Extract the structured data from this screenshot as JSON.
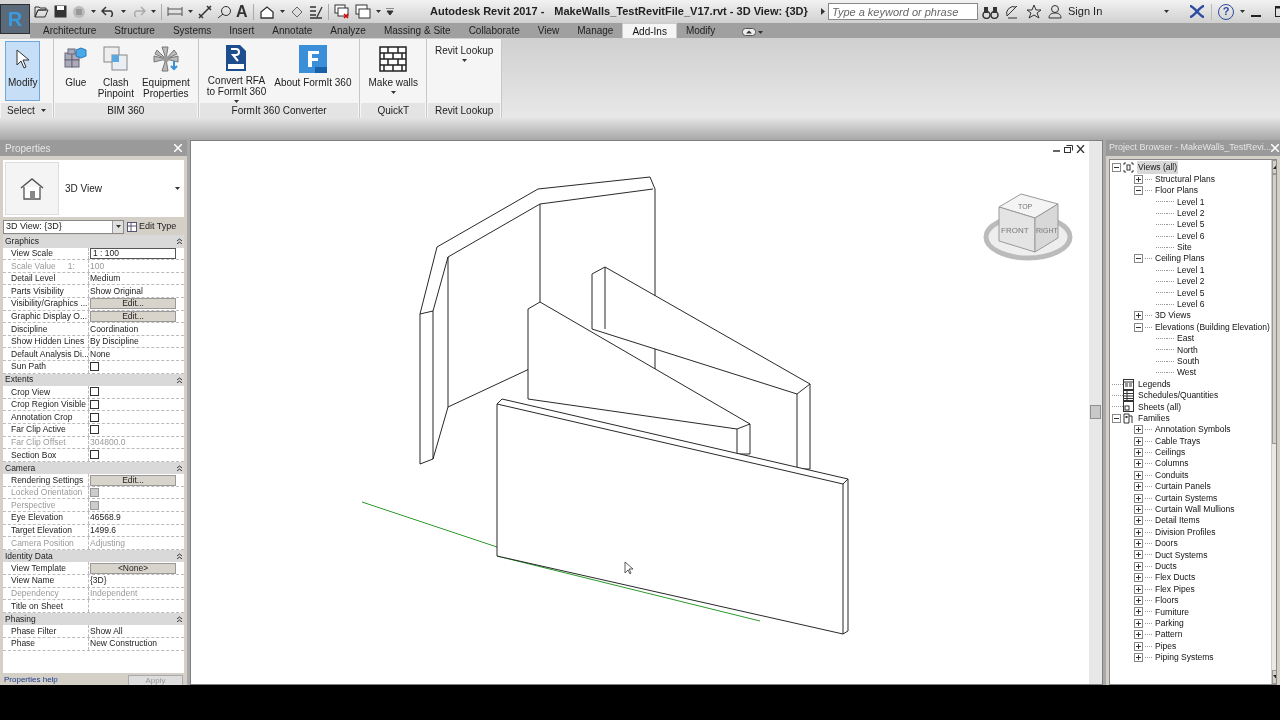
{
  "title_bar": {
    "app_button": "R",
    "text_tool": "A",
    "title_app": "Autodesk Revit 2017 -",
    "title_file": "MakeWalls_TestRevitFile_V17.rvt - 3D View: {3D}",
    "search": {
      "placeholder": "Type a keyword or phrase"
    },
    "sign_in": "Sign In",
    "help": "?"
  },
  "ribbon_tabs": [
    {
      "label": "Architecture",
      "selected": false
    },
    {
      "label": "Structure",
      "selected": false
    },
    {
      "label": "Systems",
      "selected": false
    },
    {
      "label": "Insert",
      "selected": false
    },
    {
      "label": "Annotate",
      "selected": false
    },
    {
      "label": "Analyze",
      "selected": false
    },
    {
      "label": "Massing & Site",
      "selected": false
    },
    {
      "label": "Collaborate",
      "selected": false
    },
    {
      "label": "View",
      "selected": false
    },
    {
      "label": "Manage",
      "selected": false
    },
    {
      "label": "Add-Ins",
      "selected": true
    },
    {
      "label": "Modify",
      "selected": false
    }
  ],
  "ribbon_panels": [
    {
      "title": "Select",
      "title_menu": true,
      "buttons": [
        {
          "label": "Modify",
          "kind": "cursor",
          "selected": true,
          "dropdown": false
        }
      ]
    },
    {
      "title": "BIM 360",
      "title_menu": false,
      "buttons": [
        {
          "label": "Glue",
          "kind": "cubes",
          "selected": false,
          "dropdown": false
        },
        {
          "label": "Clash\nPinpoint",
          "kind": "squares",
          "selected": false,
          "dropdown": false
        },
        {
          "label": "Equipment\nProperties",
          "kind": "fan",
          "selected": false,
          "dropdown": false
        }
      ]
    },
    {
      "title": "FormIt 360 Converter",
      "title_menu": false,
      "buttons": [
        {
          "label": "Convert RFA\nto FormIt 360",
          "kind": "rfa",
          "selected": false,
          "dropdown": true
        },
        {
          "label": "About FormIt 360",
          "kind": "formit",
          "selected": false,
          "dropdown": false
        }
      ]
    },
    {
      "title": "QuickT",
      "title_menu": false,
      "buttons": [
        {
          "label": "Make walls",
          "kind": "bricks",
          "selected": false,
          "dropdown": true
        }
      ]
    },
    {
      "title": "Revit Lookup",
      "title_menu": false,
      "buttons": [
        {
          "label": "Revit Lookup",
          "kind": "text",
          "selected": false,
          "dropdown": true
        }
      ]
    }
  ],
  "properties": {
    "title": "Properties",
    "type_name": "3D View",
    "selector": "3D View: {3D}",
    "edit_type": "Edit Type",
    "sections": [
      {
        "title": "Graphics",
        "rows": [
          {
            "label": "View Scale",
            "kind": "input",
            "value": "1 : 100",
            "disabled": false
          },
          {
            "label": "Scale Value",
            "unit": "1:",
            "kind": "text",
            "value": "100",
            "disabled": true
          },
          {
            "label": "Detail Level",
            "kind": "text",
            "value": "Medium",
            "disabled": false
          },
          {
            "label": "Parts Visibility",
            "kind": "text",
            "value": "Show Original",
            "disabled": false
          },
          {
            "label": "Visibility/Graphics ...",
            "kind": "button",
            "value": "Edit...",
            "disabled": false
          },
          {
            "label": "Graphic Display O...",
            "kind": "button",
            "value": "Edit...",
            "disabled": false
          },
          {
            "label": "Discipline",
            "kind": "text",
            "value": "Coordination",
            "disabled": false
          },
          {
            "label": "Show Hidden Lines",
            "kind": "text",
            "value": "By Discipline",
            "disabled": false
          },
          {
            "label": "Default Analysis Di...",
            "kind": "text",
            "value": "None",
            "disabled": false
          },
          {
            "label": "Sun Path",
            "kind": "checkbox",
            "checked": false,
            "disabled": false
          }
        ]
      },
      {
        "title": "Extents",
        "rows": [
          {
            "label": "Crop View",
            "kind": "checkbox",
            "checked": false,
            "disabled": false
          },
          {
            "label": "Crop Region Visible",
            "kind": "checkbox",
            "checked": false,
            "disabled": false
          },
          {
            "label": "Annotation Crop",
            "kind": "checkbox",
            "checked": false,
            "disabled": false
          },
          {
            "label": "Far Clip Active",
            "kind": "checkbox",
            "checked": false,
            "disabled": false
          },
          {
            "label": "Far Clip Offset",
            "kind": "text",
            "value": "304800.0",
            "disabled": true
          },
          {
            "label": "Section Box",
            "kind": "checkbox",
            "checked": false,
            "disabled": false
          }
        ]
      },
      {
        "title": "Camera",
        "rows": [
          {
            "label": "Rendering Settings",
            "kind": "button",
            "value": "Edit...",
            "disabled": false
          },
          {
            "label": "Locked Orientation",
            "kind": "checkbox",
            "checked": false,
            "disabled": true
          },
          {
            "label": "Perspective",
            "kind": "checkbox",
            "checked": false,
            "disabled": true
          },
          {
            "label": "Eye Elevation",
            "kind": "text",
            "value": "46568.9",
            "disabled": false
          },
          {
            "label": "Target Elevation",
            "kind": "text",
            "value": "1499.6",
            "disabled": false
          },
          {
            "label": "Camera Position",
            "kind": "text",
            "value": "Adjusting",
            "disabled": true
          }
        ]
      },
      {
        "title": "Identity Data",
        "rows": [
          {
            "label": "View Template",
            "kind": "button",
            "value": "<None>",
            "disabled": false
          },
          {
            "label": "View Name",
            "kind": "text",
            "value": "{3D}",
            "disabled": false
          },
          {
            "label": "Dependency",
            "kind": "text",
            "value": "Independent",
            "disabled": true
          },
          {
            "label": "Title on Sheet",
            "kind": "text",
            "disabled": false
          }
        ]
      },
      {
        "title": "Phasing",
        "rows": [
          {
            "label": "Phase Filter",
            "kind": "text",
            "value": "Show All",
            "disabled": false
          },
          {
            "label": "Phase",
            "kind": "text",
            "value": "New Construction",
            "disabled": false
          }
        ]
      }
    ],
    "help_link": "Properties help",
    "apply": "Apply"
  },
  "view_cube": {
    "top": "TOP",
    "front": "FRONT",
    "right": "RIGHT"
  },
  "project_browser": {
    "title": "Project Browser - MakeWalls_TestRevi...",
    "tree": [
      {
        "label": "Views (all)",
        "kind": "views",
        "expanded": true,
        "selected": true,
        "children": [
          {
            "label": "Structural Plans",
            "expanded": false
          },
          {
            "label": "Floor Plans",
            "expanded": true,
            "children": [
              {
                "label": "Level 1"
              },
              {
                "label": "Level 2"
              },
              {
                "label": "Level 5"
              },
              {
                "label": "Level 6"
              },
              {
                "label": "Site"
              }
            ]
          },
          {
            "label": "Ceiling Plans",
            "expanded": true,
            "children": [
              {
                "label": "Level 1"
              },
              {
                "label": "Level 2"
              },
              {
                "label": "Level 5"
              },
              {
                "label": "Level 6"
              }
            ]
          },
          {
            "label": "3D Views",
            "expanded": false
          },
          {
            "label": "Elevations (Building Elevation)",
            "expanded": true,
            "children": [
              {
                "label": "East"
              },
              {
                "label": "North"
              },
              {
                "label": "South"
              },
              {
                "label": "West"
              }
            ]
          }
        ]
      },
      {
        "label": "Legends",
        "kind": "legends"
      },
      {
        "label": "Schedules/Quantities",
        "kind": "schedules"
      },
      {
        "label": "Sheets (all)",
        "kind": "sheets"
      },
      {
        "label": "Families",
        "kind": "families",
        "expanded": true,
        "children": [
          {
            "label": "Annotation Symbols",
            "expanded": false
          },
          {
            "label": "Cable Trays",
            "expanded": false
          },
          {
            "label": "Ceilings",
            "expanded": false
          },
          {
            "label": "Columns",
            "expanded": false
          },
          {
            "label": "Conduits",
            "expanded": false
          },
          {
            "label": "Curtain Panels",
            "expanded": false
          },
          {
            "label": "Curtain Systems",
            "expanded": false
          },
          {
            "label": "Curtain Wall Mullions",
            "expanded": false
          },
          {
            "label": "Detail Items",
            "expanded": false
          },
          {
            "label": "Division Profiles",
            "expanded": false
          },
          {
            "label": "Doors",
            "expanded": false
          },
          {
            "label": "Duct Systems",
            "expanded": false
          },
          {
            "label": "Ducts",
            "expanded": false
          },
          {
            "label": "Flex Ducts",
            "expanded": false
          },
          {
            "label": "Flex Pipes",
            "expanded": false
          },
          {
            "label": "Floors",
            "expanded": false
          },
          {
            "label": "Furniture",
            "expanded": false
          },
          {
            "label": "Parking",
            "expanded": false
          },
          {
            "label": "Pattern",
            "expanded": false
          },
          {
            "label": "Pipes",
            "expanded": false
          },
          {
            "label": "Piping Systems",
            "expanded": false
          }
        ]
      }
    ]
  }
}
